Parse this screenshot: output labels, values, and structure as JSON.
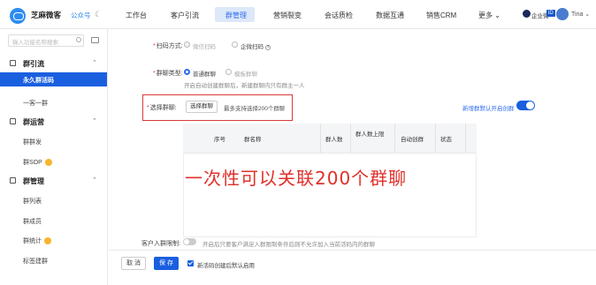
{
  "header": {
    "brand": "芝麻微客",
    "account_type": "公众号",
    "nav": [
      "工作台",
      "客户引流",
      "群管理",
      "营销裂变",
      "会话质检",
      "数据互通",
      "销售CRM",
      "更多"
    ],
    "active_nav": "群管理",
    "corp_label": "企业微",
    "corp_tag": "iD",
    "user": "Tina"
  },
  "sidebar": {
    "search_placeholder": "输入功能名称搜索",
    "groups": [
      {
        "title": "群引流",
        "items": [
          "永久群活码",
          "一客一群"
        ]
      },
      {
        "title": "群运营",
        "items": [
          "群群发",
          "群SOP"
        ]
      },
      {
        "title": "群管理",
        "items": [
          "群列表",
          "群成员",
          "群统计",
          "标签建群"
        ]
      }
    ],
    "active_item": "永久群活码"
  },
  "form": {
    "scan_label": "扫码方式:",
    "scan_opt1": "微信扫码",
    "scan_opt2": "企微扫码",
    "group_type_label": "群聊类型:",
    "group_type_opt1": "普通群聊",
    "group_type_opt2": "模板群聊",
    "group_type_hint": "开启自动创建群聊后，新建群聊内只有群主一人",
    "select_group_label": "选择群聊:",
    "select_group_button": "选择群聊",
    "select_group_hint": "最多支持选择200个群聊",
    "auto_create_label": "新增群默认开启创群",
    "auto_create_on": true,
    "table_headers": [
      "序号",
      "群名称",
      "群人数",
      "群人数上限",
      "自动创群",
      "状态"
    ],
    "overlay_text": "一次性可以关联200个群聊",
    "limit_label": "客户入群限制:",
    "limit_hint": "开启后只要客户满足入群限制条件后则不允许加入当前活码内的群聊",
    "limit_on": false
  },
  "footer": {
    "cancel": "取 消",
    "save": "保 存",
    "checkbox_label": "新活码创建后默认启用",
    "checkbox_checked": true
  }
}
